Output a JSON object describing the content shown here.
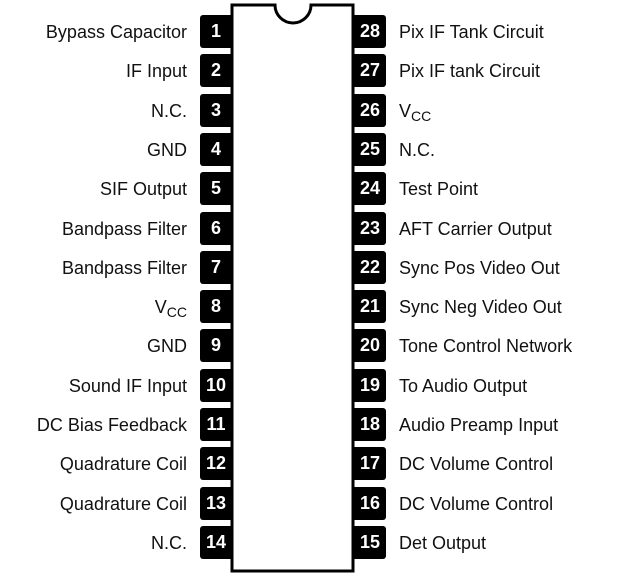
{
  "diagram": {
    "type": "DIP-28 pinout",
    "left_pins": [
      {
        "num": "1",
        "label": "Bypass Capacitor"
      },
      {
        "num": "2",
        "label": "IF Input"
      },
      {
        "num": "3",
        "label": "N.C."
      },
      {
        "num": "4",
        "label": "GND"
      },
      {
        "num": "5",
        "label": "SIF Output"
      },
      {
        "num": "6",
        "label": "Bandpass Filter"
      },
      {
        "num": "7",
        "label": "Bandpass Filter"
      },
      {
        "num": "8",
        "label": "V",
        "sub": "CC"
      },
      {
        "num": "9",
        "label": "GND"
      },
      {
        "num": "10",
        "label": "Sound IF Input"
      },
      {
        "num": "11",
        "label": "DC Bias Feedback"
      },
      {
        "num": "12",
        "label": "Quadrature Coil"
      },
      {
        "num": "13",
        "label": "Quadrature Coil"
      },
      {
        "num": "14",
        "label": "N.C."
      }
    ],
    "right_pins": [
      {
        "num": "28",
        "label": "Pix IF Tank Circuit"
      },
      {
        "num": "27",
        "label": "Pix IF tank Circuit"
      },
      {
        "num": "26",
        "label": "V",
        "sub": "CC"
      },
      {
        "num": "25",
        "label": "N.C."
      },
      {
        "num": "24",
        "label": "Test Point"
      },
      {
        "num": "23",
        "label": "AFT Carrier Output"
      },
      {
        "num": "22",
        "label": "Sync Pos Video Out"
      },
      {
        "num": "21",
        "label": "Sync Neg Video Out"
      },
      {
        "num": "20",
        "label": "Tone Control Network"
      },
      {
        "num": "19",
        "label": "To Audio Output"
      },
      {
        "num": "18",
        "label": "Audio Preamp Input"
      },
      {
        "num": "17",
        "label": "DC Volume Control"
      },
      {
        "num": "16",
        "label": "DC Volume Control"
      },
      {
        "num": "15",
        "label": "Det Output"
      }
    ]
  }
}
